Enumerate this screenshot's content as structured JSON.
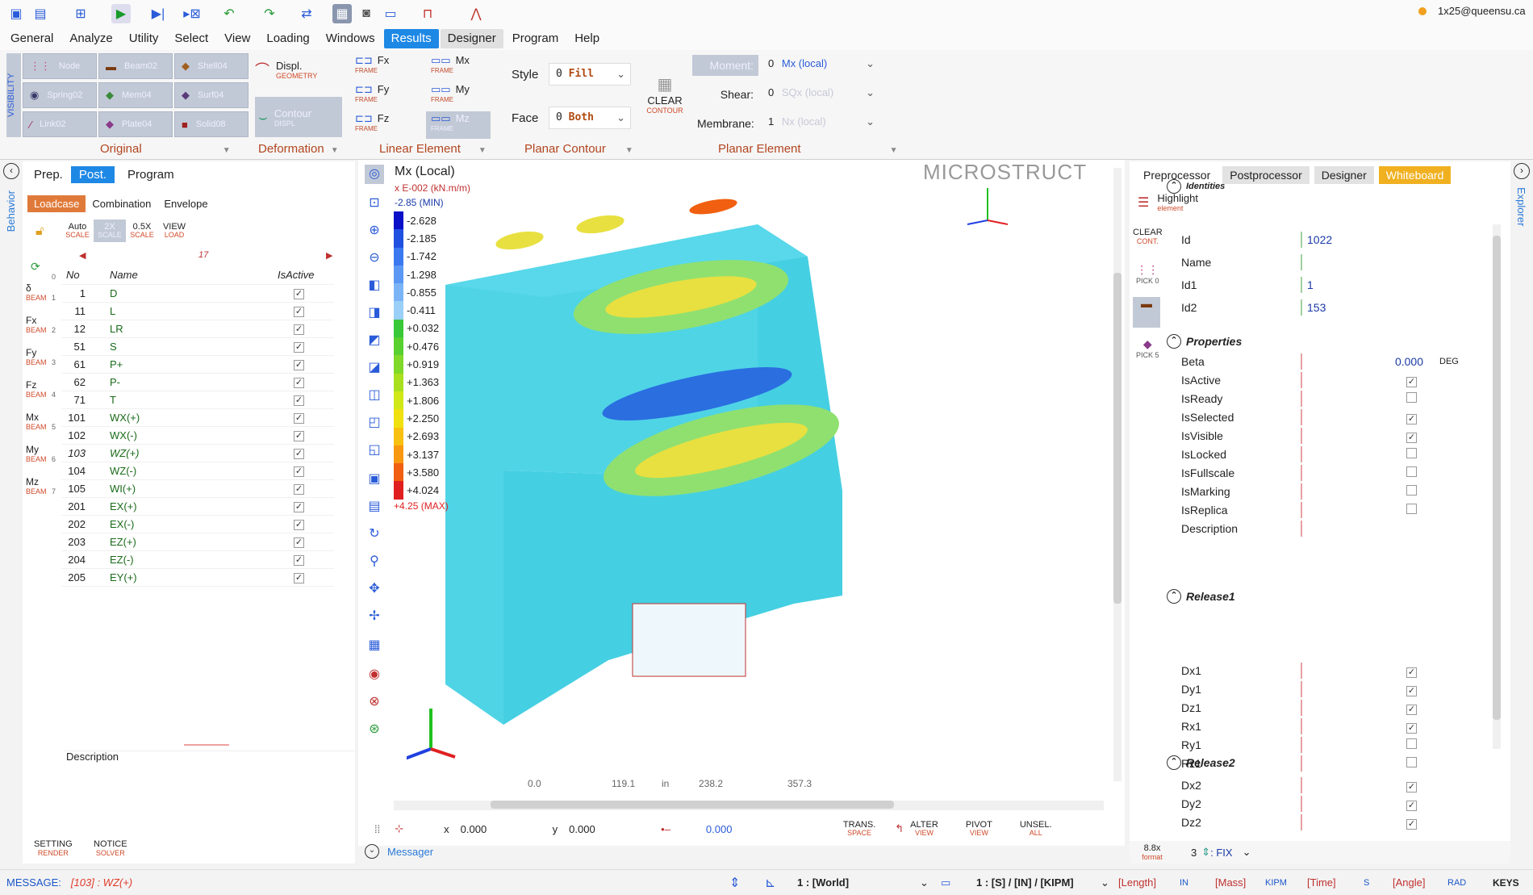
{
  "qat": {
    "user": "1x25@queensu.ca",
    "icons": [
      "save-icon",
      "save-as-icon",
      "tree-icon",
      "run-icon",
      "step-icon",
      "step-skip-icon",
      "undo-icon",
      "redo-icon",
      "swap-icon",
      "layout-icon",
      "camera-icon",
      "window-icon",
      "frame-icon",
      "truss-icon"
    ]
  },
  "menu": [
    "General",
    "Analyze",
    "Utility",
    "Select",
    "View",
    "Loading",
    "Windows",
    "Results",
    "Designer",
    "Program",
    "Help"
  ],
  "ribbon": {
    "visibility": "VISIBILITY",
    "vis_buttons": [
      "Node",
      "Beam02",
      "Shell04",
      "Spring02",
      "Mem04",
      "Surf04",
      "Link02",
      "Plate04",
      "Solid08"
    ],
    "original": "Original",
    "displ": "Displ.",
    "geometry": "GEOMETRY",
    "contour": "Contour",
    "displ_small": "DISPL",
    "deformation": "Deformation",
    "linear": [
      {
        "t": "Fx",
        "s": "FRAME"
      },
      {
        "t": "Mx",
        "s": "FRAME"
      },
      {
        "t": "Fy",
        "s": "FRAME"
      },
      {
        "t": "My",
        "s": "FRAME"
      },
      {
        "t": "Fz",
        "s": "FRAME"
      },
      {
        "t": "Mz",
        "s": "FRAME"
      }
    ],
    "linear_element": "Linear Element",
    "style": "Style",
    "style_val": "0",
    "style_opt": "Fill",
    "face": "Face",
    "face_val": "0",
    "face_opt": "Both",
    "planar_contour": "Planar Contour",
    "clear": "CLEAR",
    "clear_s": "CONTOUR",
    "moment": "Moment:",
    "moment_val": "0",
    "moment_opt": "Mx (local)",
    "shear": "Shear:",
    "shear_val": "0",
    "shear_opt": "SQx (local)",
    "membrane": "Membrane:",
    "membrane_val": "1",
    "membrane_opt": "Nx (local)",
    "planar_element": "Planar Element"
  },
  "left": {
    "side_label": "Behavior",
    "tabs": [
      "Prep.",
      "Post.",
      "Program"
    ],
    "subtabs": [
      "Loadcase",
      "Combination",
      "Envelope"
    ],
    "scale": [
      {
        "t": "Auto",
        "s": "SCALE"
      },
      {
        "t": "2X",
        "s": "SCALE"
      },
      {
        "t": "0.5X",
        "s": "SCALE"
      },
      {
        "t": "VIEW",
        "s": "LOAD"
      }
    ],
    "page": "17",
    "side_items": [
      {
        "t": "δ",
        "s": "BEAM",
        "n": "1"
      },
      {
        "t": "Fx",
        "s": "BEAM",
        "n": "2"
      },
      {
        "t": "Fy",
        "s": "BEAM",
        "n": "3"
      },
      {
        "t": "Fz",
        "s": "BEAM",
        "n": "4"
      },
      {
        "t": "Mx",
        "s": "BEAM",
        "n": "5"
      },
      {
        "t": "My",
        "s": "BEAM",
        "n": "6"
      },
      {
        "t": "Mz",
        "s": "BEAM",
        "n": "7"
      }
    ],
    "side_zero": "0",
    "headers": [
      "No",
      "Name",
      "IsActive"
    ],
    "rows": [
      [
        "1",
        "D"
      ],
      [
        "11",
        "L"
      ],
      [
        "12",
        "LR"
      ],
      [
        "51",
        "S"
      ],
      [
        "61",
        "P+"
      ],
      [
        "62",
        "P-"
      ],
      [
        "71",
        "T"
      ],
      [
        "101",
        "WX(+)"
      ],
      [
        "102",
        "WX(-)"
      ],
      [
        "103",
        "WZ(+)"
      ],
      [
        "104",
        "WZ(-)"
      ],
      [
        "105",
        "WI(+)"
      ],
      [
        "201",
        "EX(+)"
      ],
      [
        "202",
        "EX(-)"
      ],
      [
        "203",
        "EZ(+)"
      ],
      [
        "204",
        "EZ(-)"
      ],
      [
        "205",
        "EY(+)"
      ]
    ],
    "description": "Description",
    "setting": "SETTING",
    "setting_s": "RENDER",
    "notice": "NOTICE",
    "notice_s": "SOLVER"
  },
  "view": {
    "title": "Mx (Local)",
    "units": "x E-002 (kN.m/m)",
    "min": "-2.85 (MIN)",
    "max": "+4.25 (MAX)",
    "brand": "MICROSTRUCT",
    "legend": [
      "-2.628",
      "-2.185",
      "-1.742",
      "-1.298",
      "-0.855",
      "-0.411",
      "+0.032",
      "+0.476",
      "+0.919",
      "+1.363",
      "+1.806",
      "+2.250",
      "+2.693",
      "+3.137",
      "+3.580",
      "+4.024"
    ],
    "legend_colors": [
      "#0a10c8",
      "#2050e0",
      "#3a78f0",
      "#5a98f4",
      "#7ab4f6",
      "#9acff8",
      "#38c838",
      "#58d030",
      "#80d828",
      "#a8e020",
      "#d0e818",
      "#f0e010",
      "#f8c010",
      "#f89810",
      "#f06010",
      "#e02020"
    ],
    "ruler": [
      "0.0",
      "119.1",
      "in",
      "238.2",
      "357.3"
    ],
    "x_label": "x",
    "x_val": "0.000",
    "y_label": "y",
    "y_val": "0.000",
    "z_val": "0.000",
    "bottom_tools": [
      {
        "t": "TRANS.",
        "s": "SPACE"
      },
      {
        "t": "ALTER",
        "s": "VIEW"
      },
      {
        "t": "PIVOT",
        "s": "VIEW"
      },
      {
        "t": "UNSEL.",
        "s": "ALL"
      }
    ],
    "messager": "Messager"
  },
  "right": {
    "side_label": "Explorer",
    "tabs": [
      "Preprocessor",
      "Postprocessor",
      "Designer",
      "Whiteboard"
    ],
    "highlight": "Highlight",
    "highlight_s": "element",
    "clear": "CLEAR",
    "clear_s": "CONT.",
    "pick": "PICK",
    "pick0": "0",
    "pick5": "5",
    "identities": "Identities",
    "id": [
      [
        "Id",
        "1022"
      ],
      [
        "Name",
        ""
      ],
      [
        "Id1",
        "1"
      ],
      [
        "Id2",
        "153"
      ]
    ],
    "properties": "Properties",
    "beta_label": "Beta",
    "beta_val": "0.000",
    "beta_unit": "DEG",
    "props": [
      [
        "IsActive",
        true
      ],
      [
        "IsReady",
        false
      ],
      [
        "IsSelected",
        true
      ],
      [
        "IsVisible",
        true
      ],
      [
        "IsLocked",
        false
      ],
      [
        "IsFullscale",
        false
      ],
      [
        "IsMarking",
        false
      ],
      [
        "IsReplica",
        false
      ]
    ],
    "description": "Description",
    "release1": "Release1",
    "r1": [
      [
        "Dx1",
        true
      ],
      [
        "Dy1",
        true
      ],
      [
        "Dz1",
        true
      ],
      [
        "Rx1",
        true
      ],
      [
        "Ry1",
        false
      ],
      [
        "Rz1",
        false
      ]
    ],
    "release2": "Release2",
    "r2": [
      [
        "Dx2",
        true
      ],
      [
        "Dy2",
        true
      ],
      [
        "Dz2",
        true
      ]
    ],
    "format": "8.8x",
    "format_s": "format",
    "digits": "3",
    "fix": ": FIX"
  },
  "status": {
    "message": "MESSAGE:",
    "msg_val": "[103] : WZ(+)",
    "coord": "1 : [World]",
    "units": "1 : [S] / [IN] / [KIPM]",
    "length": "[Length]",
    "length_v": "IN",
    "mass": "[Mass]",
    "mass_v": "KIPM",
    "time": "[Time]",
    "time_v": "S",
    "angle": "[Angle]",
    "angle_v": "RAD",
    "keys": "KEYS"
  }
}
